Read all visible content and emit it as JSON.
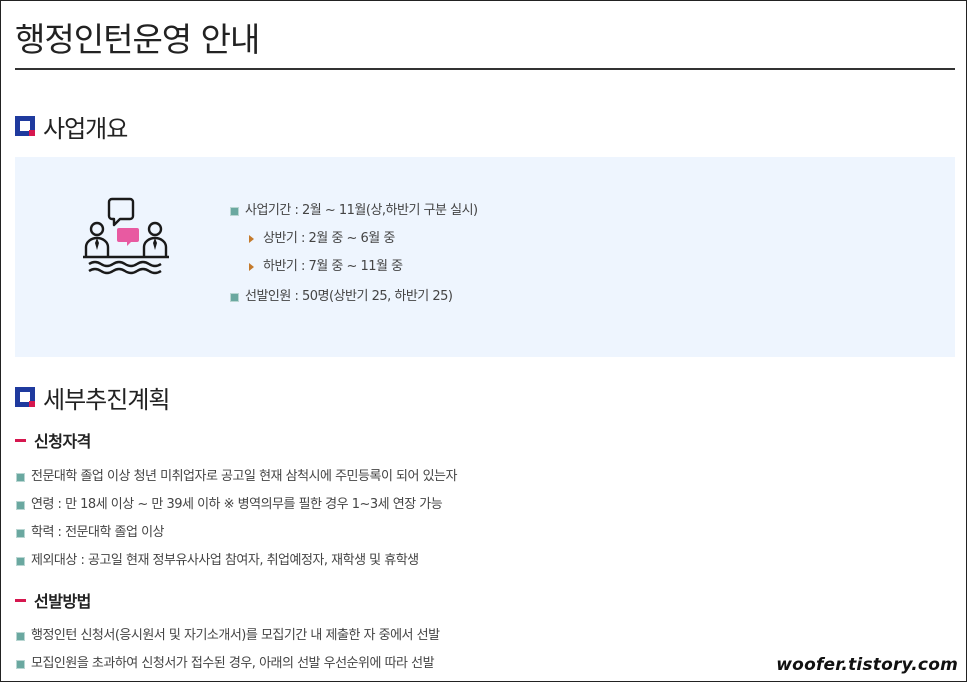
{
  "page": {
    "title": "행정인턴운영 안내"
  },
  "overview": {
    "heading": "사업개요",
    "items": [
      {
        "text": "사업기간 : 2월 ~ 11월(상,하반기 구분 실시)",
        "level": 1
      },
      {
        "text": "상반기 : 2월 중 ~ 6월 중",
        "level": 2
      },
      {
        "text": "하반기 : 7월 중 ~ 11월 중",
        "level": 2
      },
      {
        "text": "선발인원 : 50명(상반기 25, 하반기 25)",
        "level": 1
      }
    ],
    "icon": "meeting-discussion-icon"
  },
  "plan": {
    "heading": "세부추진계획",
    "eligibility": {
      "heading": "신청자격",
      "items": [
        "전문대학 졸업 이상 청년 미취업자로 공고일 현재 삼척시에 주민등록이 되어 있는자",
        "연령 : 만 18세 이상 ~ 만 39세 이하 ※ 병역의무를 필한 경우 1~3세 연장 가능",
        "학력 : 전문대학 졸업 이상",
        "제외대상 : 공고일 현재 정부유사사업 참여자, 취업예정자, 재학생 및 휴학생"
      ]
    },
    "selection": {
      "heading": "선발방법",
      "items": [
        "행정인턴 신청서(응시원서 및 자기소개서)를 모집기간 내 제출한 자 중에서 선발",
        "모집인원을 초과하여 신청서가 접수된 경우, 아래의 선발 우선순위에 따라 선발"
      ]
    }
  },
  "watermark": "woofer.tistory.com",
  "colors": {
    "accent_blue": "#1f3a9e",
    "accent_red": "#d6174f",
    "box_bg": "#eef5fe"
  }
}
